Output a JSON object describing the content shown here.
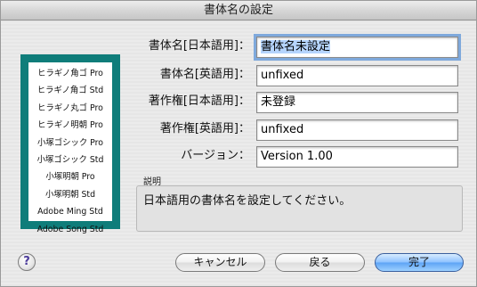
{
  "window": {
    "title": "書体名の設定"
  },
  "preview": {
    "lines": [
      "ヒラギノ角ゴ Pro",
      "ヒラギノ角ゴ Std",
      "ヒラギノ丸ゴ Pro",
      "ヒラギノ明朝 Pro",
      "小塚ゴシック Pro",
      "小塚ゴシック Std",
      "小塚明朝 Pro",
      "小塚明朝 Std",
      "Adobe Ming Std",
      "Adobe Song Std"
    ]
  },
  "form": {
    "font_name_ja_label": "書体名[日本語用]：",
    "font_name_ja_value": "書体名未設定",
    "font_name_en_label": "書体名[英語用]：",
    "font_name_en_value": "unfixed",
    "copyright_ja_label": "著作権[日本語用]：",
    "copyright_ja_value": "未登録",
    "copyright_en_label": "著作権[英語用]：",
    "copyright_en_value": "unfixed",
    "version_label": "バージョン：",
    "version_value": "Version 1.00"
  },
  "description": {
    "label": "説明",
    "text": "日本語用の書体名を設定してください。"
  },
  "buttons": {
    "help": "?",
    "cancel": "キャンセル",
    "back": "戻る",
    "done": "完了"
  }
}
